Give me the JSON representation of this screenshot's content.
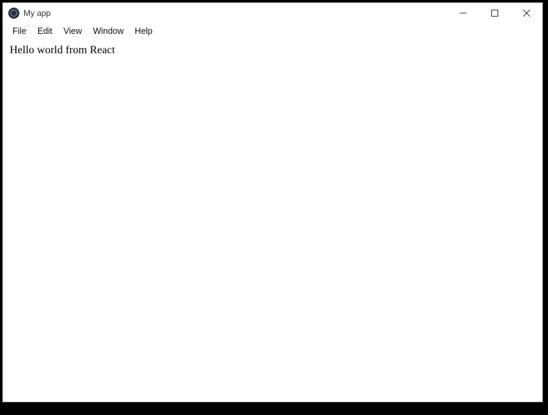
{
  "titlebar": {
    "app_title": "My app",
    "icon_name": "electron-app-icon"
  },
  "window_controls": {
    "minimize_label": "Minimize",
    "maximize_label": "Maximize",
    "close_label": "Close"
  },
  "menubar": {
    "items": [
      {
        "label": "File"
      },
      {
        "label": "Edit"
      },
      {
        "label": "View"
      },
      {
        "label": "Window"
      },
      {
        "label": "Help"
      }
    ]
  },
  "content": {
    "hello_text": "Hello world from React"
  }
}
